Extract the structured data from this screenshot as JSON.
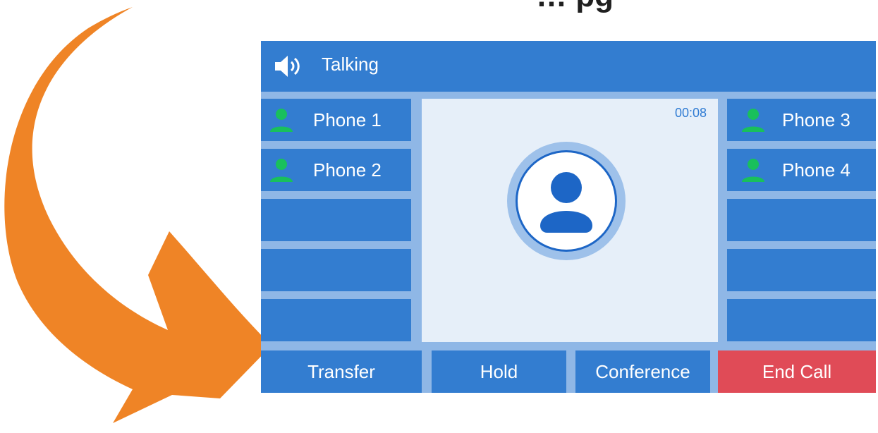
{
  "page": {
    "background_text": "… pg"
  },
  "phone": {
    "status_title": "Talking",
    "timer": "00:08",
    "line_keys_left": [
      "Phone 1",
      "Phone 2",
      "",
      "",
      ""
    ],
    "line_keys_right": [
      "Phone 3",
      "Phone 4",
      "",
      "",
      ""
    ],
    "softkeys": {
      "transfer": "Transfer",
      "hold": "Hold",
      "conference": "Conference",
      "end_call": "End Call"
    },
    "colors": {
      "primary_blue": "#337dd0",
      "panel_bg": "#e6eff9",
      "end_call_red": "#e04b57",
      "presence_green": "#19c05c",
      "arrow_orange": "#ef8426"
    },
    "icons": {
      "speaker": "speaker-icon",
      "contact": "contact-avatar-icon",
      "presence": "presence-person-icon"
    }
  }
}
